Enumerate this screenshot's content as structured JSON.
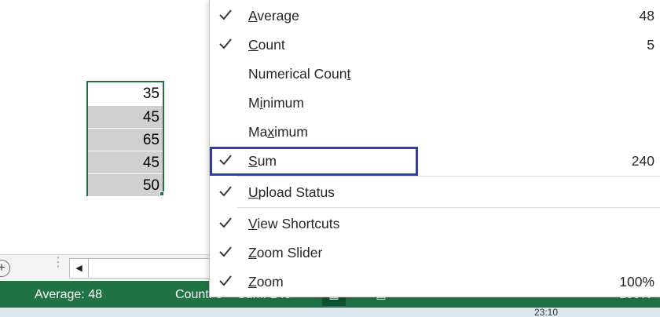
{
  "sheet": {
    "cells": [
      "35",
      "45",
      "65",
      "45",
      "50"
    ]
  },
  "tabbar": {
    "add_sheet": "+",
    "scroll_left": "◀"
  },
  "statusbar": {
    "average": "Average: 48",
    "count_partial": "Count: 5",
    "sum_partial": "Sum: 240",
    "zoom_partial": "100%",
    "bg_color": "#217346"
  },
  "taskbar": {
    "clock_partial": "23:10"
  },
  "menu": {
    "items": [
      {
        "label_pre": "",
        "label_ul": "A",
        "label_post": "verage",
        "value": "48",
        "checked": true
      },
      {
        "label_pre": "",
        "label_ul": "C",
        "label_post": "ount",
        "value": "5",
        "checked": true
      },
      {
        "label_pre": "Numerical Coun",
        "label_ul": "t",
        "label_post": "",
        "value": "",
        "checked": false
      },
      {
        "label_pre": "M",
        "label_ul": "i",
        "label_post": "nimum",
        "value": "",
        "checked": false
      },
      {
        "label_pre": "Ma",
        "label_ul": "x",
        "label_post": "imum",
        "value": "",
        "checked": false
      },
      {
        "label_pre": "",
        "label_ul": "S",
        "label_post": "um",
        "value": "240",
        "checked": true
      },
      {
        "label_pre": "",
        "label_ul": "U",
        "label_post": "pload Status",
        "value": "",
        "checked": true
      },
      {
        "label_pre": "",
        "label_ul": "V",
        "label_post": "iew Shortcuts",
        "value": "",
        "checked": true
      },
      {
        "label_pre": "",
        "label_ul": "Z",
        "label_post": "oom Slider",
        "value": "",
        "checked": true
      },
      {
        "label_pre": "",
        "label_ul": "Z",
        "label_post": "oom",
        "value": "100%",
        "checked": true
      }
    ],
    "highlight_color": "#2b3ea8"
  }
}
